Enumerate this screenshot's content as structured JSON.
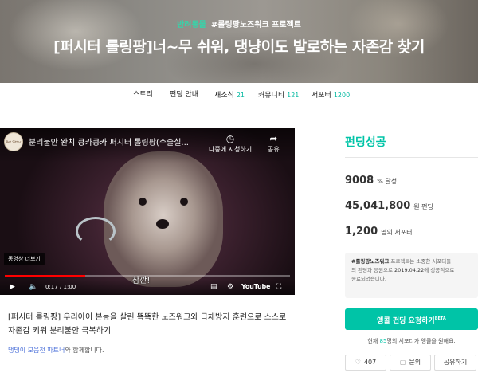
{
  "hero": {
    "category": "반려동물",
    "project_tag": "#롤링팡노즈워크 프로젝트",
    "title": "[퍼시터 롤링팡]너~무 쉬워, 댕냥이도 발로하는 자존감 찾기"
  },
  "tabs": [
    {
      "label": "스토리",
      "count": ""
    },
    {
      "label": "펀딩 안내",
      "count": ""
    },
    {
      "label": "새소식",
      "count": "21"
    },
    {
      "label": "커뮤니티",
      "count": "121"
    },
    {
      "label": "서포터",
      "count": "1200"
    }
  ],
  "video": {
    "channel_badge": "Pet Sitter",
    "title": "분리불안 완치 킁카킁카 퍼시터 롤링팡(수술실...",
    "watch_later_label": "나중에 시청하기",
    "share_label": "공유",
    "more_videos_label": "동영상 더보기",
    "caption": "참깐!",
    "time": "0:17 / 1:00",
    "progress": 0.283,
    "youtube_label": "YouTube"
  },
  "summary": {
    "description": "[퍼시터 롤링팡] 우리아이 본능을 살린 똑똑한 노즈워크와 급체방지 훈련으로 스스로 자존감 키워 분리불안 극복하기",
    "partner_link": "댕댕이 모음전 파트너",
    "partner_suffix": "와 함께합니다."
  },
  "panel": {
    "status": "펀딩성공",
    "percent_value": "9008",
    "percent_unit": "% 달성",
    "amount_value": "45,041,800",
    "amount_unit": "원 펀딩",
    "supporters_value": "1,200",
    "supporters_unit": "명의 서포터",
    "notice_project": "#롤링팡노즈워크",
    "notice_line1_suffix": " 프로젝트는 소중한 서포터들",
    "notice_line2_prefix": "의 펀딩과 응원으로 ",
    "notice_date": "2019.04.22",
    "notice_line2_suffix": "에 성공적으로",
    "notice_line3": "종료되었습니다.",
    "cta_label": "앵콜 펀딩 요청하기",
    "cta_badge": "BETA",
    "waiting_prefix": "현재 ",
    "waiting_count": "85",
    "waiting_suffix": "명의 서포터가 앵콜을 원해요.",
    "like_count": "407",
    "inquiry_label": "문의",
    "share_label": "공유하기"
  },
  "colors": {
    "accent": "#00c4a7",
    "partner_link": "#4a6fd9",
    "progress": "#ff0000"
  }
}
